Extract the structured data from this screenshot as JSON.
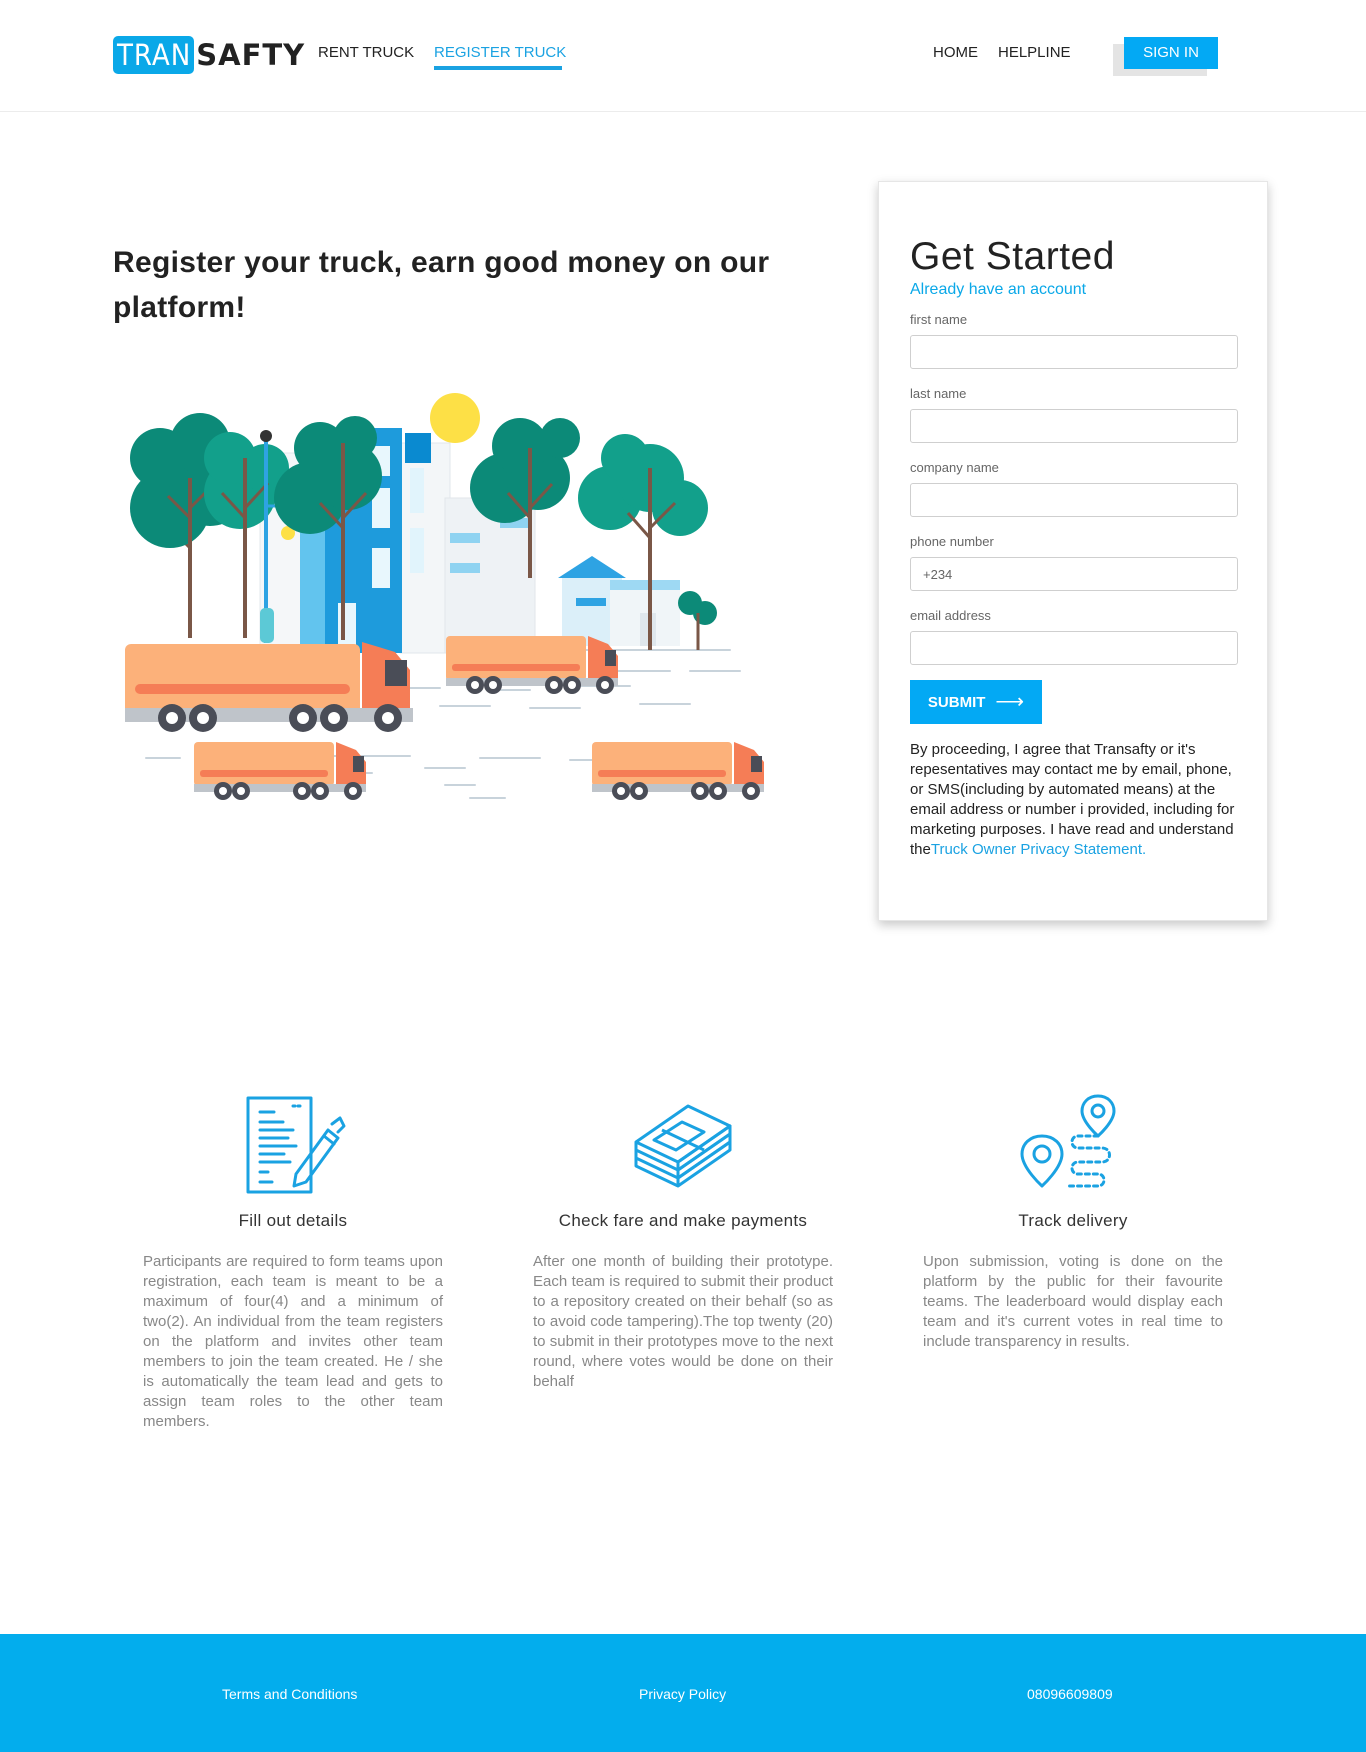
{
  "brand": {
    "logo_part1": "TRAN",
    "logo_part2": "SAFTY",
    "accent": "#03a9f4",
    "text_dark": "#222222",
    "text_muted": "#888888"
  },
  "nav": {
    "left": [
      {
        "label": "RENT TRUCK",
        "active": false
      },
      {
        "label": "REGISTER TRUCK",
        "active": true
      }
    ],
    "right": [
      {
        "label": "HOME"
      },
      {
        "label": "HELPLINE"
      }
    ],
    "signin_label": "SIGN IN"
  },
  "hero": {
    "title": "Register your truck, earn good money on our platform!",
    "illustration": "city-trucks-illustration"
  },
  "form": {
    "title": "Get Started",
    "account_link": "Already have an account",
    "fields": [
      {
        "label": "first name",
        "value": "",
        "placeholder": ""
      },
      {
        "label": "last name",
        "value": "",
        "placeholder": ""
      },
      {
        "label": "company name",
        "value": "",
        "placeholder": ""
      },
      {
        "label": "phone number",
        "value": "",
        "placeholder": "+234"
      },
      {
        "label": "email address",
        "value": "",
        "placeholder": ""
      }
    ],
    "submit_label": "SUBMIT",
    "submit_icon": "arrow-right-icon",
    "consent_text": "By proceeding, I agree that Transafty or it's repesentatives may contact me by email, phone, or SMS(including by automated means) at the email address or number i provided, including for marketing purposes. I have read and understand the",
    "consent_link": "Truck Owner Privacy Statement."
  },
  "features": [
    {
      "icon": "document-pen-icon",
      "title": "Fill out details",
      "text": "Participants are required to form teams upon registration, each team is meant to be a maximum of four(4) and a minimum of two(2). An individual from the team registers on the platform and invites other team members to join the team created. He / she is automatically the team lead and gets to assign team roles to the other team members."
    },
    {
      "icon": "money-stack-icon",
      "title": "Check fare and make payments",
      "text": "After one month of building their prototype. Each team is required to submit their product to a repository created on their behalf (so as to avoid code tampering).The top twenty (20) to submit in their prototypes move to the next round, where votes would be done on their behalf"
    },
    {
      "icon": "map-route-icon",
      "title": "Track delivery",
      "text": "Upon submission, voting is done on the platform by the public for their favourite teams. The leaderboard would display each team and it's current votes in real time to include transparency in results."
    }
  ],
  "footer": {
    "links": [
      "Terms and Conditions",
      "Privacy Policy",
      "08096609809"
    ]
  }
}
